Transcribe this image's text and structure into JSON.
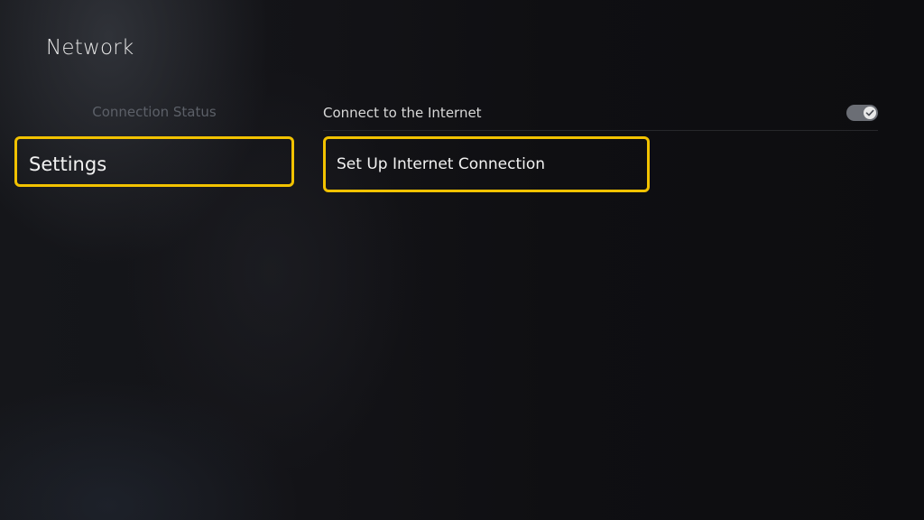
{
  "page": {
    "title": "Network"
  },
  "left_menu": {
    "items": [
      {
        "label": "Connection Status",
        "selected": false
      },
      {
        "label": "Settings",
        "selected": true
      }
    ]
  },
  "right_panel": {
    "toggle_row": {
      "label": "Connect to the Internet",
      "toggle_on": true,
      "icon": "check-icon"
    },
    "action": {
      "label": "Set Up Internet Connection"
    }
  },
  "colors": {
    "focus_border": "#f2c200",
    "background": "#131317",
    "dim_text": "#5c6068",
    "bright_text": "#f2f2f2"
  }
}
